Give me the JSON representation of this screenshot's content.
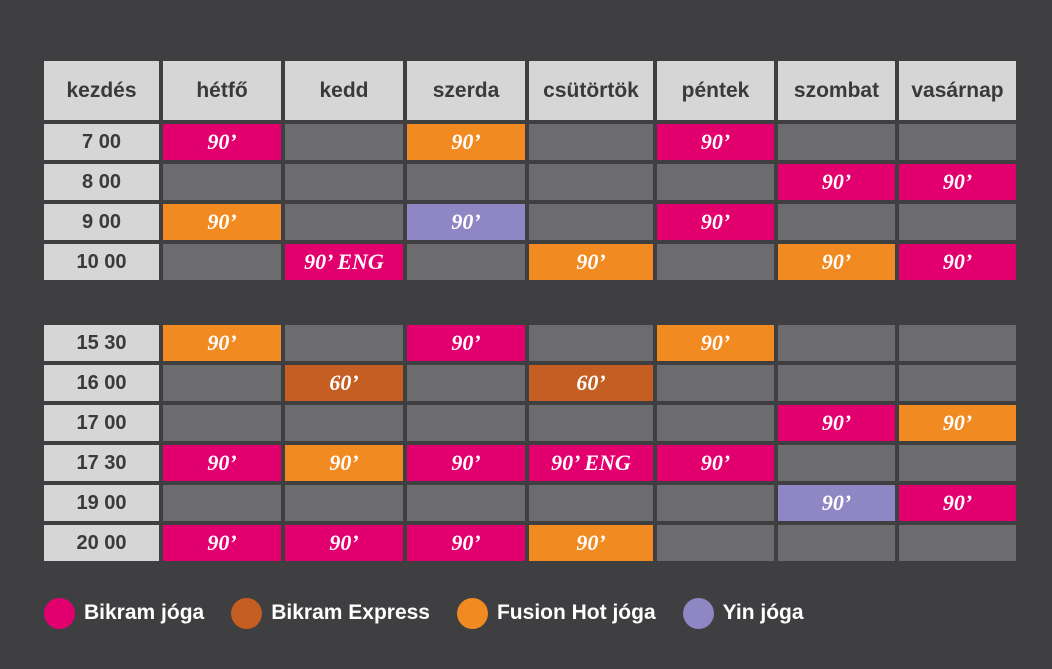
{
  "colors": {
    "background": "#3f3e40",
    "header_bg": "#d6d6d6",
    "empty_cell": "#6c6c6e",
    "bikram": "#e2006e",
    "express": "#c45e22",
    "fusion": "#f28a22",
    "yin": "#8f86c4"
  },
  "header": [
    "kezdés",
    "hétfő",
    "kedd",
    "szerda",
    "csütörtök",
    "péntek",
    "szombat",
    "vasárnap"
  ],
  "blocks": [
    {
      "rows": [
        {
          "time": "7 00",
          "cells": [
            {
              "t": "90’",
              "c": "bikram"
            },
            null,
            {
              "t": "90’",
              "c": "fusion"
            },
            null,
            {
              "t": "90’",
              "c": "bikram"
            },
            null,
            null
          ]
        },
        {
          "time": "8 00",
          "cells": [
            null,
            null,
            null,
            null,
            null,
            {
              "t": "90’",
              "c": "bikram"
            },
            {
              "t": "90’",
              "c": "bikram"
            }
          ]
        },
        {
          "time": "9 00",
          "cells": [
            {
              "t": "90’",
              "c": "fusion"
            },
            null,
            {
              "t": "90’",
              "c": "yin"
            },
            null,
            {
              "t": "90’",
              "c": "bikram"
            },
            null,
            null
          ]
        },
        {
          "time": "10 00",
          "cells": [
            null,
            {
              "t": "90’ ENG",
              "c": "bikram"
            },
            null,
            {
              "t": "90’",
              "c": "fusion"
            },
            null,
            {
              "t": "90’",
              "c": "fusion"
            },
            {
              "t": "90’",
              "c": "bikram"
            }
          ]
        }
      ]
    },
    {
      "rows": [
        {
          "time": "15 30",
          "cells": [
            {
              "t": "90’",
              "c": "fusion"
            },
            null,
            {
              "t": "90’",
              "c": "bikram"
            },
            null,
            {
              "t": "90’",
              "c": "fusion"
            },
            null,
            null
          ]
        },
        {
          "time": "16 00",
          "cells": [
            null,
            {
              "t": "60’",
              "c": "express"
            },
            null,
            {
              "t": "60’",
              "c": "express"
            },
            null,
            null,
            null
          ]
        },
        {
          "time": "17 00",
          "cells": [
            null,
            null,
            null,
            null,
            null,
            {
              "t": "90’",
              "c": "bikram"
            },
            {
              "t": "90’",
              "c": "fusion"
            }
          ]
        },
        {
          "time": "17 30",
          "cells": [
            {
              "t": "90’",
              "c": "bikram"
            },
            {
              "t": "90’",
              "c": "fusion"
            },
            {
              "t": "90’",
              "c": "bikram"
            },
            {
              "t": "90’ ENG",
              "c": "bikram"
            },
            {
              "t": "90’",
              "c": "bikram"
            },
            null,
            null
          ]
        },
        {
          "time": "19 00",
          "cells": [
            null,
            null,
            null,
            null,
            null,
            {
              "t": "90’",
              "c": "yin"
            },
            {
              "t": "90’",
              "c": "bikram"
            }
          ]
        },
        {
          "time": "20 00",
          "cells": [
            {
              "t": "90’",
              "c": "bikram"
            },
            {
              "t": "90’",
              "c": "bikram"
            },
            {
              "t": "90’",
              "c": "bikram"
            },
            {
              "t": "90’",
              "c": "fusion"
            },
            null,
            null,
            null
          ]
        }
      ]
    }
  ],
  "legend": [
    {
      "label": "Bikram jóga",
      "color": "bikram"
    },
    {
      "label": "Bikram Express",
      "color": "express"
    },
    {
      "label": "Fusion Hot jóga",
      "color": "fusion"
    },
    {
      "label": "Yin jóga",
      "color": "yin"
    }
  ]
}
